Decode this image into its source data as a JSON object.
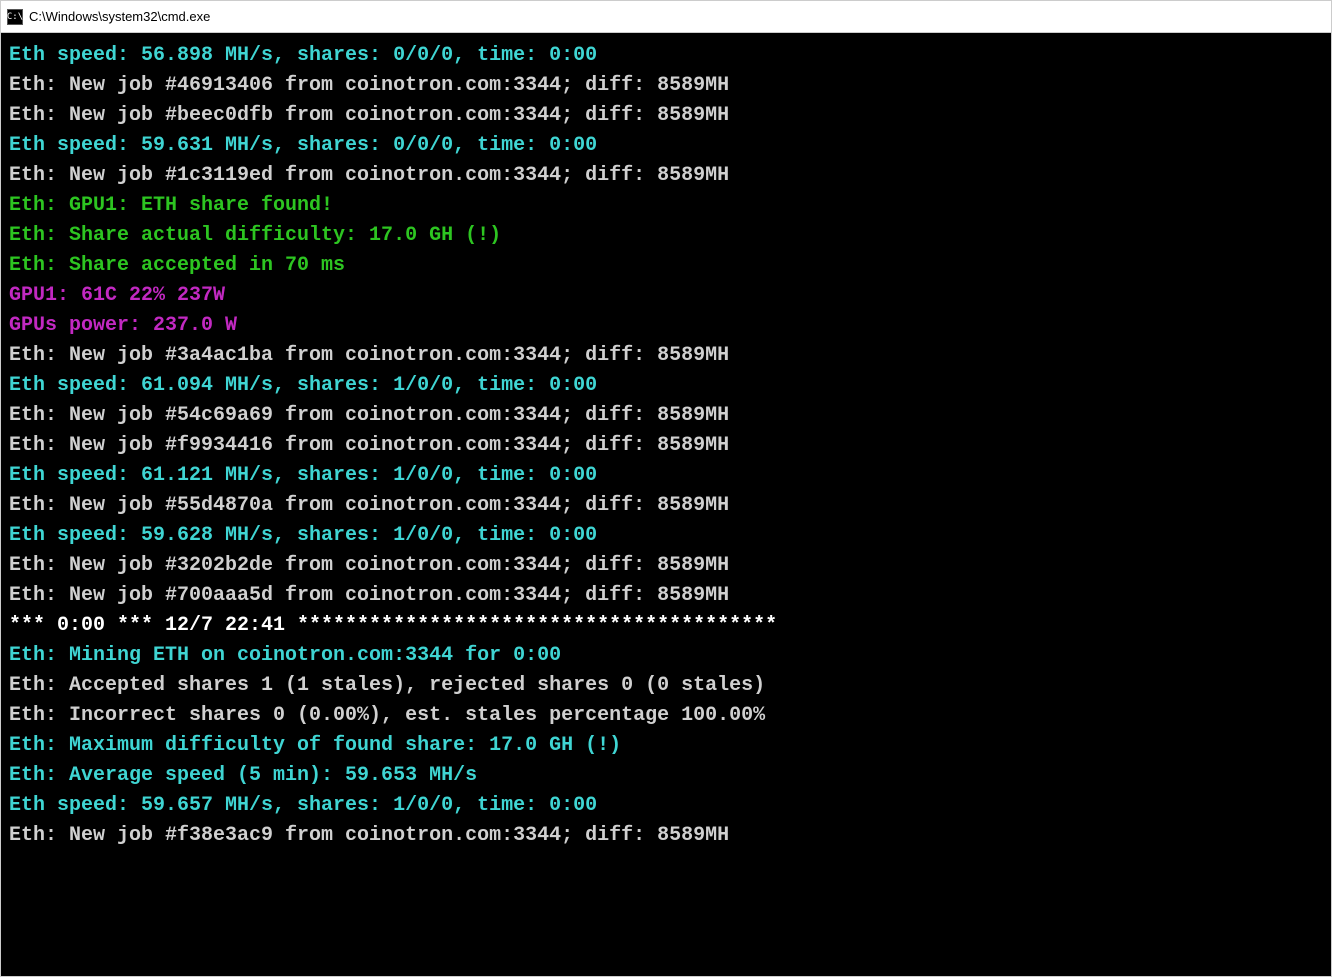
{
  "window": {
    "title": "C:\\Windows\\system32\\cmd.exe",
    "icon_text": "C:\\"
  },
  "terminal": {
    "lines": [
      {
        "class": "cyan",
        "text": "Eth speed: 56.898 MH/s, shares: 0/0/0, time: 0:00"
      },
      {
        "class": "white",
        "text": "Eth: New job #46913406 from coinotron.com:3344; diff: 8589MH"
      },
      {
        "class": "white",
        "text": "Eth: New job #beec0dfb from coinotron.com:3344; diff: 8589MH"
      },
      {
        "class": "cyan",
        "text": "Eth speed: 59.631 MH/s, shares: 0/0/0, time: 0:00"
      },
      {
        "class": "white",
        "text": "Eth: New job #1c3119ed from coinotron.com:3344; diff: 8589MH"
      },
      {
        "class": "green",
        "text": "Eth: GPU1: ETH share found!"
      },
      {
        "class": "green",
        "text": "Eth: Share actual difficulty: 17.0 GH (!)"
      },
      {
        "class": "green",
        "text": "Eth: Share accepted in 70 ms"
      },
      {
        "class": "magenta",
        "text": "GPU1: 61C 22% 237W"
      },
      {
        "class": "magenta",
        "text": "GPUs power: 237.0 W"
      },
      {
        "class": "white",
        "text": "Eth: New job #3a4ac1ba from coinotron.com:3344; diff: 8589MH"
      },
      {
        "class": "cyan",
        "text": "Eth speed: 61.094 MH/s, shares: 1/0/0, time: 0:00"
      },
      {
        "class": "white",
        "text": "Eth: New job #54c69a69 from coinotron.com:3344; diff: 8589MH"
      },
      {
        "class": "white",
        "text": "Eth: New job #f9934416 from coinotron.com:3344; diff: 8589MH"
      },
      {
        "class": "cyan",
        "text": "Eth speed: 61.121 MH/s, shares: 1/0/0, time: 0:00"
      },
      {
        "class": "white",
        "text": "Eth: New job #55d4870a from coinotron.com:3344; diff: 8589MH"
      },
      {
        "class": "cyan",
        "text": "Eth speed: 59.628 MH/s, shares: 1/0/0, time: 0:00"
      },
      {
        "class": "white",
        "text": "Eth: New job #3202b2de from coinotron.com:3344; diff: 8589MH"
      },
      {
        "class": "white",
        "text": "Eth: New job #700aaa5d from coinotron.com:3344; diff: 8589MH"
      },
      {
        "class": "white",
        "text": ""
      },
      {
        "class": "bold-white",
        "text": "*** 0:00 *** 12/7 22:41 ****************************************"
      },
      {
        "class": "cyan",
        "text": "Eth: Mining ETH on coinotron.com:3344 for 0:00"
      },
      {
        "class": "white",
        "text": "Eth: Accepted shares 1 (1 stales), rejected shares 0 (0 stales)"
      },
      {
        "class": "white",
        "text": "Eth: Incorrect shares 0 (0.00%), est. stales percentage 100.00%"
      },
      {
        "class": "cyan",
        "text": "Eth: Maximum difficulty of found share: 17.0 GH (!)"
      },
      {
        "class": "cyan",
        "text": "Eth: Average speed (5 min): 59.653 MH/s"
      },
      {
        "class": "white",
        "text": ""
      },
      {
        "class": "cyan",
        "text": "Eth speed: 59.657 MH/s, shares: 1/0/0, time: 0:00"
      },
      {
        "class": "white",
        "text": "Eth: New job #f38e3ac9 from coinotron.com:3344; diff: 8589MH"
      }
    ]
  }
}
